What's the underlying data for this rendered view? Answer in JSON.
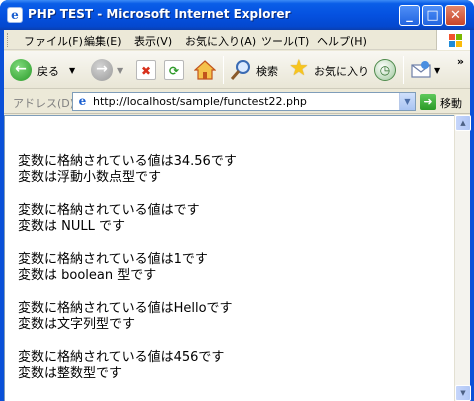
{
  "window": {
    "title": "PHP TEST - Microsoft Internet Explorer",
    "minimize_glyph": "_",
    "maximize_glyph": "□",
    "close_glyph": "✕"
  },
  "menu": {
    "items": [
      {
        "label": "ファイル(F)"
      },
      {
        "label": "編集(E)"
      },
      {
        "label": "表示(V)"
      },
      {
        "label": "お気に入り(A)"
      },
      {
        "label": "ツール(T)"
      },
      {
        "label": "ヘルプ(H)"
      }
    ]
  },
  "toolbar": {
    "back_label": "戻る",
    "search_label": "検索",
    "favorites_label": "お気に入り",
    "more_glyph": "»",
    "icons": {
      "back": "back-arrow-icon",
      "forward": "forward-arrow-icon",
      "stop": "stop-icon",
      "refresh": "refresh-icon",
      "home": "home-icon",
      "search": "search-icon",
      "favorites": "favorites-star-icon",
      "history": "history-icon",
      "mail": "mail-icon"
    }
  },
  "address": {
    "label": "アドレス(D)",
    "url": "http://localhost/sample/functest22.php",
    "go_label": "移動"
  },
  "content": {
    "lines": [
      "変数に格納されている値は34.56です",
      "変数は浮動小数点型です",
      "",
      "変数に格納されている値はです",
      "変数は NULL です",
      "",
      "変数に格納されている値は1です",
      "変数は boolean 型です",
      "",
      "変数に格納されている値はHelloです",
      "変数は文字列型です",
      "",
      "変数に格納されている値は456です",
      "変数は整数型です"
    ]
  },
  "colors": {
    "titlebar": "#0551e0",
    "chrome": "#ece9d8",
    "content_bg": "#ffffff",
    "text": "#000000"
  }
}
